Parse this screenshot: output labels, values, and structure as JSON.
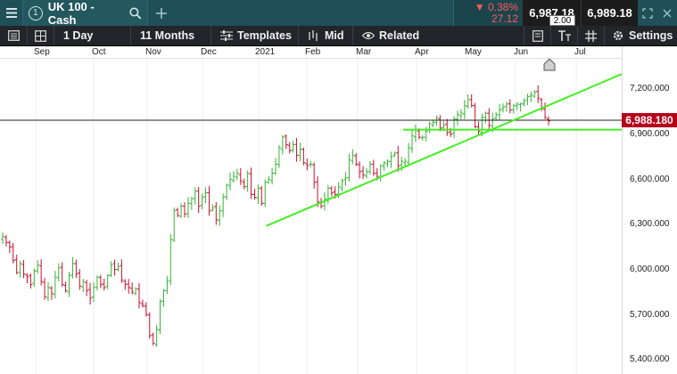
{
  "topbar": {
    "tab_number": "1",
    "instrument": "UK 100 - Cash",
    "change_pct": "▼ 0.38%",
    "change_abs": "27.12",
    "sell_price": "6,987.18",
    "buy_price": "6,989.18",
    "spread": "2.00"
  },
  "toolbar": {
    "interval": "1 Day",
    "range": "11 Months",
    "templates": "Templates",
    "price_type": "Mid",
    "related": "Related",
    "settings": "Settings"
  },
  "icons": {
    "menu": "hamburger-icon",
    "search": "search-icon",
    "add": "plus-icon",
    "fullscreen": "expand-icon",
    "close": "close-icon",
    "layout": "grid-icon",
    "templates": "sliders-icon",
    "candles": "bars-icon",
    "related": "eye-icon",
    "notes": "notepad-icon",
    "text": "text-tool-icon",
    "hashtag": "hash-icon",
    "settings": "gear-icon"
  },
  "colors": {
    "up": "#36b336",
    "down": "#c8102e",
    "trendline": "#44ee22",
    "price_tag": "#b5001a"
  },
  "chart_data": {
    "type": "ohlc",
    "x_labels": [
      "Sep",
      "Oct",
      "Nov",
      "Dec",
      "2021",
      "Feb",
      "Mar",
      "Apr",
      "May",
      "Jun",
      "Jul"
    ],
    "y_ticks": [
      "7,200.000",
      "6,900.000",
      "6,600.000",
      "6,300.000",
      "6,000.000",
      "5,700.000",
      "5,400.000"
    ],
    "ylim": [
      5400,
      7350
    ],
    "current_price": "6,988.180",
    "closes": [
      6220,
      6180,
      6150,
      6060,
      5980,
      6040,
      5970,
      5950,
      5900,
      5990,
      6030,
      5920,
      5820,
      5880,
      5840,
      5950,
      6010,
      5900,
      5860,
      5960,
      6040,
      5970,
      5890,
      5920,
      5860,
      5810,
      5880,
      5950,
      5900,
      5880,
      5960,
      6030,
      6000,
      6020,
      5930,
      5900,
      5880,
      5850,
      5870,
      5780,
      5760,
      5700,
      5560,
      5510,
      5600,
      5790,
      5860,
      5920,
      6200,
      6390,
      6360,
      6420,
      6370,
      6440,
      6470,
      6520,
      6420,
      6480,
      6510,
      6390,
      6410,
      6330,
      6390,
      6480,
      6560,
      6600,
      6620,
      6640,
      6590,
      6550,
      6640,
      6500,
      6480,
      6540,
      6440,
      6580,
      6600,
      6640,
      6700,
      6810,
      6880,
      6830,
      6790,
      6830,
      6760,
      6800,
      6710,
      6690,
      6700,
      6580,
      6450,
      6420,
      6470,
      6540,
      6510,
      6500,
      6550,
      6590,
      6610,
      6730,
      6760,
      6700,
      6650,
      6630,
      6650,
      6700,
      6640,
      6620,
      6690,
      6710,
      6720,
      6750,
      6770,
      6690,
      6720,
      6720,
      6810,
      6890,
      6930,
      6880,
      6880,
      6920,
      6970,
      6980,
      7010,
      6940,
      6960,
      6910,
      6900,
      7000,
      7030,
      7040,
      7090,
      7130,
      7090,
      6950,
      6920,
      7010,
      7040,
      6960,
      7000,
      7030,
      7060,
      7080,
      7100,
      7060,
      7090,
      7100,
      7100,
      7120,
      7150,
      7160,
      7180,
      7140,
      7070,
      7010,
      6988
    ],
    "trendlines": [
      {
        "points": [
          [
            0.43,
            6290
          ],
          [
            1.0,
            7300
          ]
        ]
      },
      {
        "points": [
          [
            0.65,
            6930
          ],
          [
            1.0,
            6930
          ]
        ]
      }
    ]
  }
}
